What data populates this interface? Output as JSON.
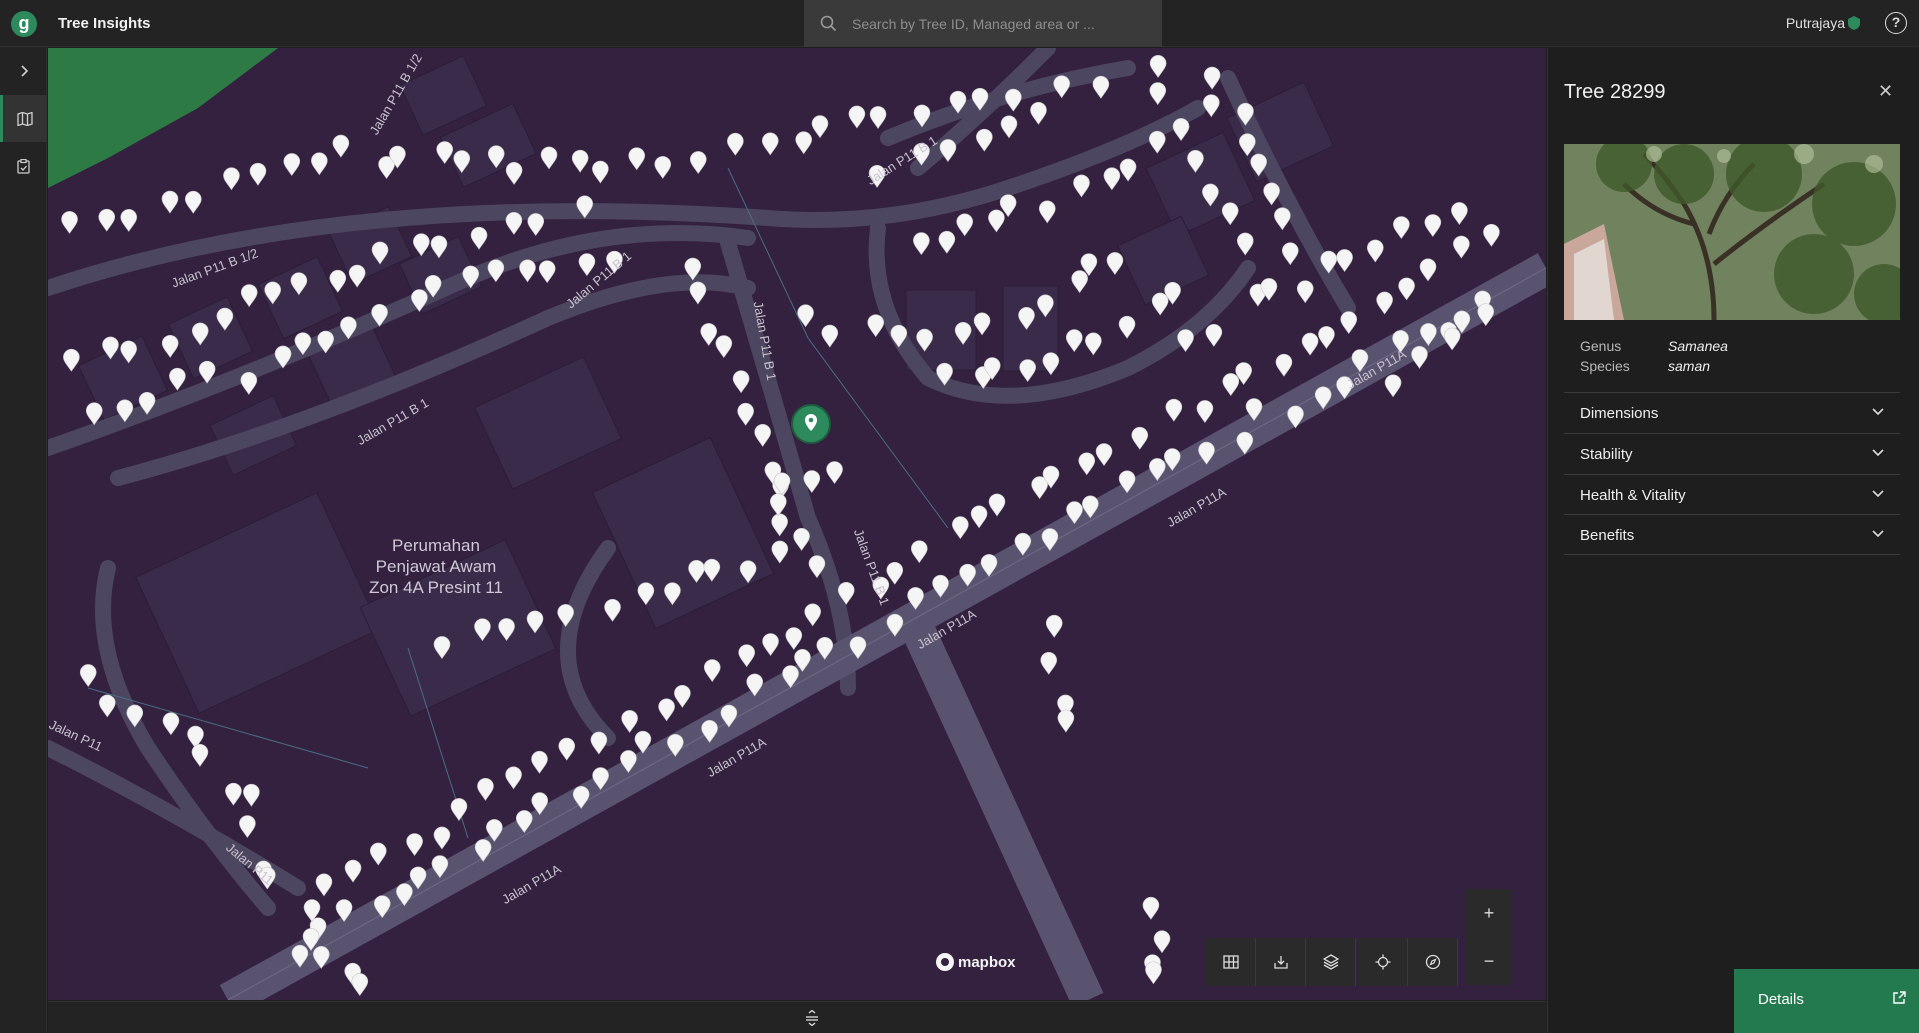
{
  "app": {
    "logo_letter": "g",
    "title": "Tree Insights"
  },
  "search": {
    "placeholder": "Search by Tree ID, Managed area or ..."
  },
  "org": {
    "name": "Putrajaya"
  },
  "map": {
    "area_label": "Perumahan\nPenjawat Awam\nZon 4A Presint 11",
    "road_labels": [
      "Jalan P11 B 1/2",
      "Jalan P11 B 1/2",
      "Jalan P11 B 1",
      "Jalan P11 B 1",
      "Jalan P11 B 1",
      "Jalan P11 B 1",
      "Jalan P11 B 1",
      "Jalan P11A",
      "Jalan P11A",
      "Jalan P11A",
      "Jalan P11A",
      "Jalan P11A",
      "Jalan P11",
      "Jalan P11"
    ],
    "attribution": "mapbox",
    "zoom_in": "+",
    "zoom_out": "−"
  },
  "panel": {
    "title": "Tree 28299",
    "attributes": [
      {
        "label": "Genus",
        "value": "Samanea"
      },
      {
        "label": "Species",
        "value": "saman"
      }
    ],
    "sections": [
      "Dimensions",
      "Stability",
      "Health & Vitality",
      "Benefits"
    ],
    "details_button": "Details"
  },
  "colors": {
    "accent": "#2c8a5d",
    "map_background": "#33213f",
    "road": "#4d4660",
    "building": "#3b2b4a"
  }
}
